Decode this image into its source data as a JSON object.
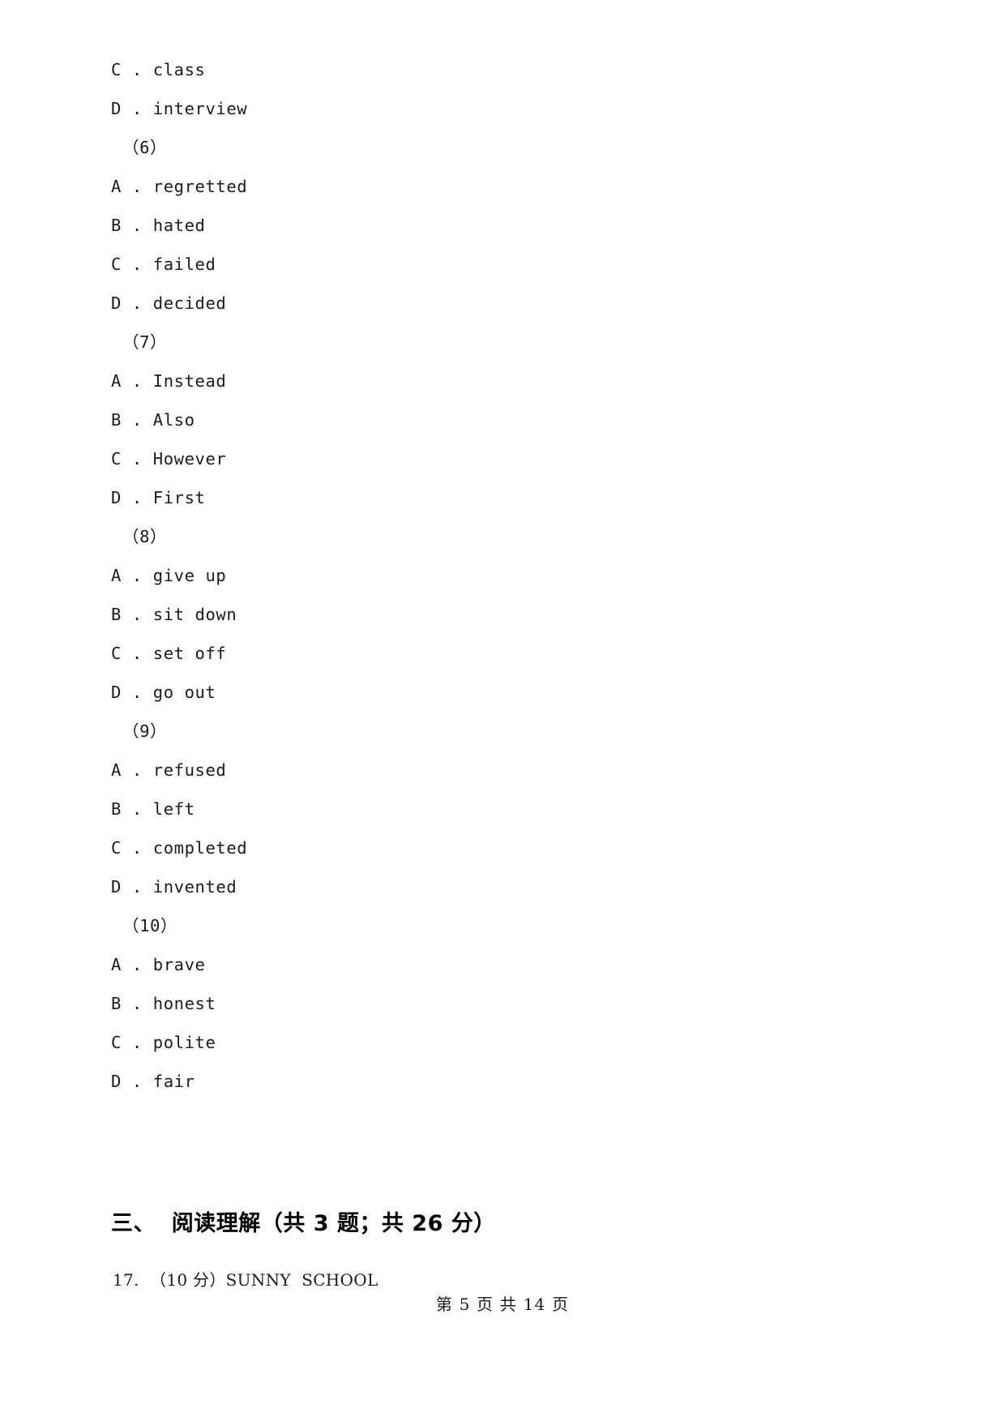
{
  "document": {
    "type": "exam-paper-page",
    "language": "zh-CN",
    "text_color": "#1b1b1b",
    "background_color": "#ffffff"
  },
  "body_lines": [
    {
      "kind": "option",
      "text": "C . class"
    },
    {
      "kind": "option",
      "text": "D . interview"
    },
    {
      "kind": "question",
      "text": "（6）"
    },
    {
      "kind": "option",
      "text": "A . regretted"
    },
    {
      "kind": "option",
      "text": "B . hated"
    },
    {
      "kind": "option",
      "text": "C . failed"
    },
    {
      "kind": "option",
      "text": "D . decided"
    },
    {
      "kind": "question",
      "text": "（7）"
    },
    {
      "kind": "option",
      "text": "A . Instead"
    },
    {
      "kind": "option",
      "text": "B . Also"
    },
    {
      "kind": "option",
      "text": "C . However"
    },
    {
      "kind": "option",
      "text": "D . First"
    },
    {
      "kind": "question",
      "text": "（8）"
    },
    {
      "kind": "option",
      "text": "A . give up"
    },
    {
      "kind": "option",
      "text": "B . sit down"
    },
    {
      "kind": "option",
      "text": "C . set off"
    },
    {
      "kind": "option",
      "text": "D . go out"
    },
    {
      "kind": "question",
      "text": "（9）"
    },
    {
      "kind": "option",
      "text": "A . refused"
    },
    {
      "kind": "option",
      "text": "B . left"
    },
    {
      "kind": "option",
      "text": "C . completed"
    },
    {
      "kind": "option",
      "text": "D . invented"
    },
    {
      "kind": "question",
      "text": "（10）"
    },
    {
      "kind": "option",
      "text": "A . brave"
    },
    {
      "kind": "option",
      "text": "B . honest"
    },
    {
      "kind": "option",
      "text": "C . polite"
    },
    {
      "kind": "option",
      "text": "D . fair"
    }
  ],
  "section_heading": {
    "text": "三、  阅读理解（共 3 题；共 26 分）",
    "number": "三、",
    "title": "阅读理解",
    "meta": "（共 3 题；共 26 分）",
    "question_count": 3,
    "points": 26
  },
  "question_17": {
    "text": "17.  （10 分）SUNNY  SCHOOL",
    "number": "17.",
    "points_label": "（10 分）",
    "points": 10,
    "title": "SUNNY  SCHOOL"
  },
  "footer": {
    "text": "第 5 页 共 14 页",
    "current_page": 5,
    "total_pages": 14
  }
}
